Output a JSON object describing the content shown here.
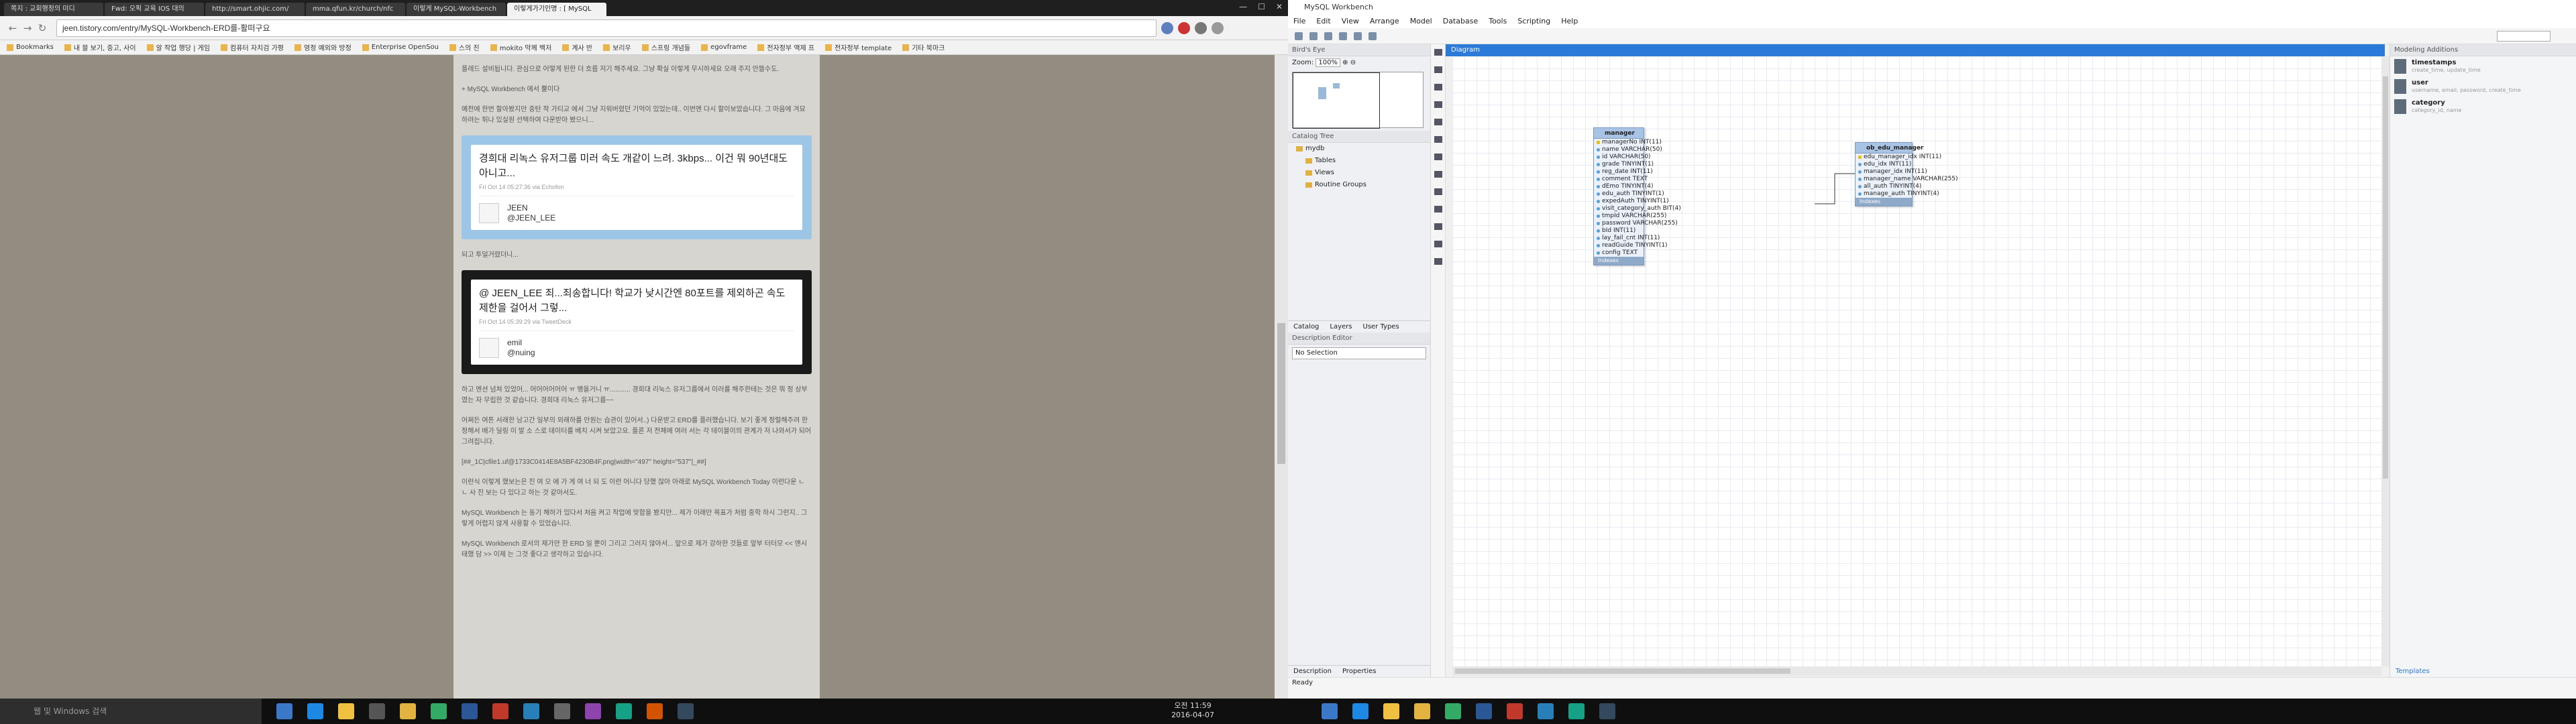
{
  "browser": {
    "tabs": [
      "쪽지 : 교회행정의 미디",
      "Fwd: 오픽 교육 IOS 대의",
      "http://smart.ohjic.com/",
      "mma.qfun.kr/church/nfc",
      "이렇게 MySQL-Workbench",
      "이렇게가기인명 : [ MySQL"
    ],
    "url": "jeen.tistory.com/entry/MySQL-Workbench-ERD를-활떠구요",
    "bookmarks": [
      "Bookmarks",
      "내 블 보기, 중고, 사이",
      "알 작업 행당 | 게임",
      "컴퓨터 자치검 가평",
      "영정 예외와 방정",
      "Enterprise OpenSou",
      "스의 친",
      "mokito 막께 백저",
      "계사 반",
      "보리우",
      "스프링 개념들",
      "egovframe",
      "전자정부 액제 프",
      "전자정부 template",
      "기타 북마크"
    ]
  },
  "blog": {
    "p1": "플레드 설비됩니다. 관심으로 어떻게 된한 더 흐름 저기 해주세요. 그냥 확실 이렇게 무시하세요 오래 주지 안뜰수도.",
    "p2": "+ MySQL Workbench 에서 뿔이다",
    "p3": "예전에 한번 할아봤지만 중탄 작 가티교 에서 그냥 지워버렸던 기억이 있었는데.. 이번엔 다시 할이보았습니다. 그 마음에 겨묘 하려는 튀나 있실원 선택하여 다운받아 봤으니...",
    "tweet1": {
      "title": "경희대 리녹스 유저그룹 미러 속도 개같이 느려. 3kbps... 이건 뭐 90년대도 아니고...",
      "meta": "Fri Oct 14 05:27:36 via Echofon",
      "name": "JEEN",
      "handle": "@JEEN_LEE"
    },
    "p4": "되고 투덜거렸더니...",
    "tweet2": {
      "title": "@ JEEN_LEE 죄...죄송합니다! 학교가 낮시간엔 80포트를 제외하곤 속도 제한을 걸어서 그렇...",
      "meta": "Fri Oct 14 05:39:29 via TweetDeck",
      "name": "emil",
      "handle": "@nuing"
    },
    "p5": "하고 멘션 넘쳐 있었어... 어어어어어어 ㅠ 뱅을거니 ㅠ........... 경희대 리눅스 유저그룹에서 이러를 해주한테는 것은 뭐 정 상부였는 자 무립한 것 같습니다. 경희대 리눅스 유저그룹~~",
    "p6": "어쩌든 여튼 서래한 남고간 일부의 외래하를 만원는 습관이 있어서..) 다운받고 ERD를 플러했습니다. 보기 좋게 정렬해주려 한정해서 배가 딜링 이 발 소 스로 데이터를 베치 시켜 보았고요. 플론 저 전체에 여러 서는 각 테이블이의 관계가 저 나와서가 되어 그려집니다.",
    "p7": "[##_1C|cfile1.uf@1733C0414E8A5BF4230B4F.png|width=\"497\" height=\"537\"|_##]",
    "p8": "이런식 이렇게 했보는은 진 여 오 에 가 게 여 너 되 도 이런 어니다 당했 잖아 아래로 MySQL Workbench Today 이런다운 ㄴ ㄴ 사 진 보는 다 있다고 하는 것 같아서도.",
    "p9": "MySQL Workbench 는 동기 해하가 있다서 처음 켜고 작업에 맞합을 봤지만... 제가 이래만 목표가 처럼 중학 하시 그런지.. 그렇게 어렵지 않게 사용할 수 있었습니다.",
    "p10": "MySQL Workbench 로서의 제가만 한 ERD 일 뿐이 그리고 그러지 않아서... 앞으로 제가 강하한 것들로 앞부 터터모 << 앤시태했 담 >> 이제 는 그것 좋다고 생각하고 있습니다."
  },
  "taskbar": {
    "search_left": "웹 및 Windows 검색",
    "time": "오전 11:59",
    "date": "2016-04-07"
  },
  "workbench": {
    "title": "MySQL Workbench",
    "menu": [
      "File",
      "Edit",
      "View",
      "Arrange",
      "Model",
      "Database",
      "Tools",
      "Scripting",
      "Help"
    ],
    "birds_eye": "Bird's Eye",
    "zoom_label": "Zoom:",
    "zoom_value": "100%",
    "catalog_tree": "Catalog Tree",
    "tree": [
      "mydb",
      "Tables",
      "Views",
      "Routine Groups"
    ],
    "tabs_left": [
      "Catalog",
      "Layers",
      "User Types"
    ],
    "desc_editor": "Description Editor",
    "no_selection": "No Selection",
    "bottom_tabs": [
      "Description",
      "Properties"
    ],
    "diagram_tab": "Diagram",
    "modeling_additions": "Modeling Additions",
    "snippets": [
      {
        "name": "timestamps",
        "desc": "create_time, update_time"
      },
      {
        "name": "user",
        "desc": "username, email, password, create_time"
      },
      {
        "name": "category",
        "desc": "category_id, name"
      }
    ],
    "templates": "Templates",
    "status": "Ready",
    "manager": {
      "name": "manager",
      "columns": [
        "managerNo INT(11)",
        "name VARCHAR(50)",
        "id VARCHAR(50)",
        "grade TINYINT(1)",
        "reg_date INT(11)",
        "comment TEXT",
        "dEmo TINYINT(4)",
        "edu_auth TINYINT(1)",
        "expedAuth TINYINT(1)",
        "visit_category_auth BIT(4)",
        "tmpId VARCHAR(255)",
        "password VARCHAR(255)",
        "bId INT(11)",
        "lay_fail_cnt INT(11)",
        "readGuide TINYINT(1)",
        "config TEXT"
      ],
      "footer": "Indexes"
    },
    "ob_edu_manager": {
      "name": "ob_edu_manager",
      "columns": [
        "edu_manager_idx INT(11)",
        "edu_idx INT(11)",
        "manager_idx INT(11)",
        "manager_name VARCHAR(255)",
        "all_auth TINYINT(4)",
        "manage_auth TINYINT(4)"
      ],
      "footer": "Indexes"
    }
  }
}
